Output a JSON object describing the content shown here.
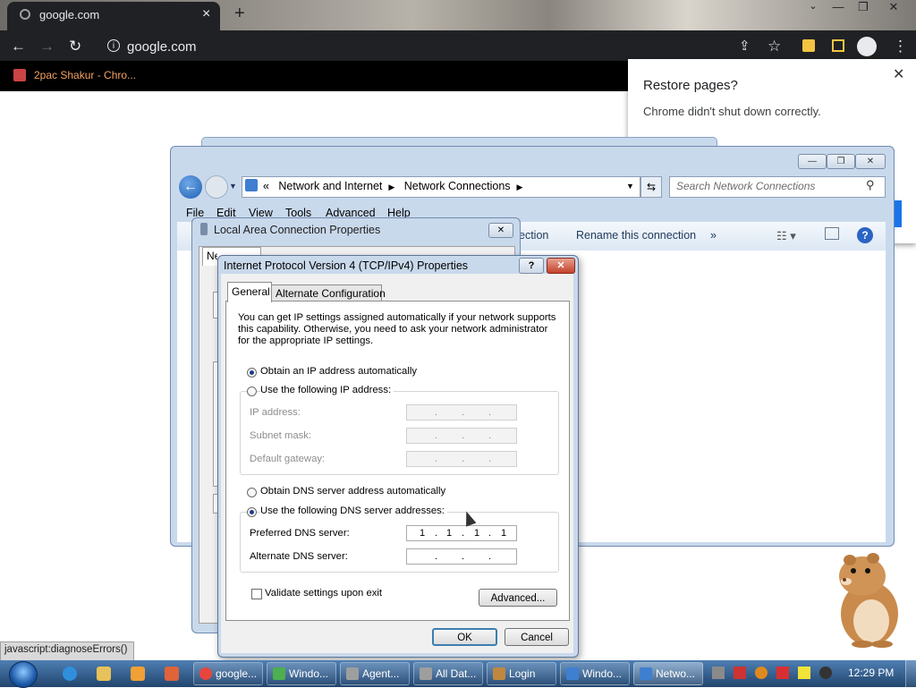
{
  "browser": {
    "tab_title": "google.com",
    "tab_close": "×",
    "new_tab": "+",
    "url": "google.com",
    "bookmark": "2pac Shakur - Chro...",
    "window_buttons": {
      "minimize": "—",
      "restore": "❐",
      "close": "✕"
    },
    "toolbar_icons": [
      "back-icon",
      "forward-icon",
      "reload-icon",
      "share-icon",
      "star-icon",
      "extensions-icon",
      "side-panel-icon",
      "profile-icon",
      "menu-icon"
    ]
  },
  "restore_popup": {
    "title": "Restore pages?",
    "message": "Chrome didn't shut down correctly.",
    "close": "✕"
  },
  "network_window": {
    "breadcrumb_sep": "«",
    "crumbs": [
      "Network and Internet",
      "Network Connections"
    ],
    "search_placeholder": "Search Network Connections",
    "menu": [
      "File",
      "Edit",
      "View",
      "Tools",
      "Advanced",
      "Help"
    ],
    "commands": {
      "partial": "ection",
      "rename": "Rename this connection",
      "more": "»"
    },
    "caption": {
      "minimize": "—",
      "maximize": "❐",
      "close": "✕"
    }
  },
  "lac_properties": {
    "title": "Local Area Connection Properties",
    "tab": "Networking",
    "close": "✕"
  },
  "ipv4": {
    "title": "Internet Protocol Version 4 (TCP/IPv4) Properties",
    "help": "?",
    "close": "✕",
    "tabs": [
      "General",
      "Alternate Configuration"
    ],
    "intro": "You can get IP settings assigned automatically if your network supports this capability. Otherwise, you need to ask your network administrator for the appropriate IP settings.",
    "ip_auto": "Obtain an IP address automatically",
    "ip_manual": "Use the following IP address:",
    "ip_mode": "auto",
    "ip_fields": [
      {
        "label": "IP address:",
        "value": [
          "",
          "",
          "",
          ""
        ]
      },
      {
        "label": "Subnet mask:",
        "value": [
          "",
          "",
          "",
          ""
        ]
      },
      {
        "label": "Default gateway:",
        "value": [
          "",
          "",
          "",
          ""
        ]
      }
    ],
    "dns_auto": "Obtain DNS server address automatically",
    "dns_manual": "Use the following DNS server addresses:",
    "dns_mode": "manual",
    "dns_fields": [
      {
        "label": "Preferred DNS server:",
        "value": [
          "1",
          "1",
          "1",
          "1"
        ]
      },
      {
        "label": "Alternate DNS server:",
        "value": [
          "",
          "",
          "",
          ""
        ]
      }
    ],
    "validate_label": "Validate settings upon exit",
    "validate_checked": false,
    "advanced": "Advanced...",
    "ok": "OK",
    "cancel": "Cancel"
  },
  "status_bar": "javascript:diagnoseErrors()",
  "taskbar": {
    "buttons": [
      {
        "label": "google...",
        "icon_color": "#e8453c"
      },
      {
        "label": "Windo...",
        "icon_color": "#4caf50"
      },
      {
        "label": "Agent...",
        "icon_color": "#9e9e9e"
      },
      {
        "label": "All Dat...",
        "icon_color": "#9e9e9e"
      },
      {
        "label": "Login",
        "icon_color": "#c0873f"
      },
      {
        "label": "Windo...",
        "icon_color": "#3f7fd0"
      },
      {
        "label": "Netwo...",
        "icon_color": "#3f7fd0",
        "active": true
      }
    ],
    "clock": "12:29 PM"
  }
}
